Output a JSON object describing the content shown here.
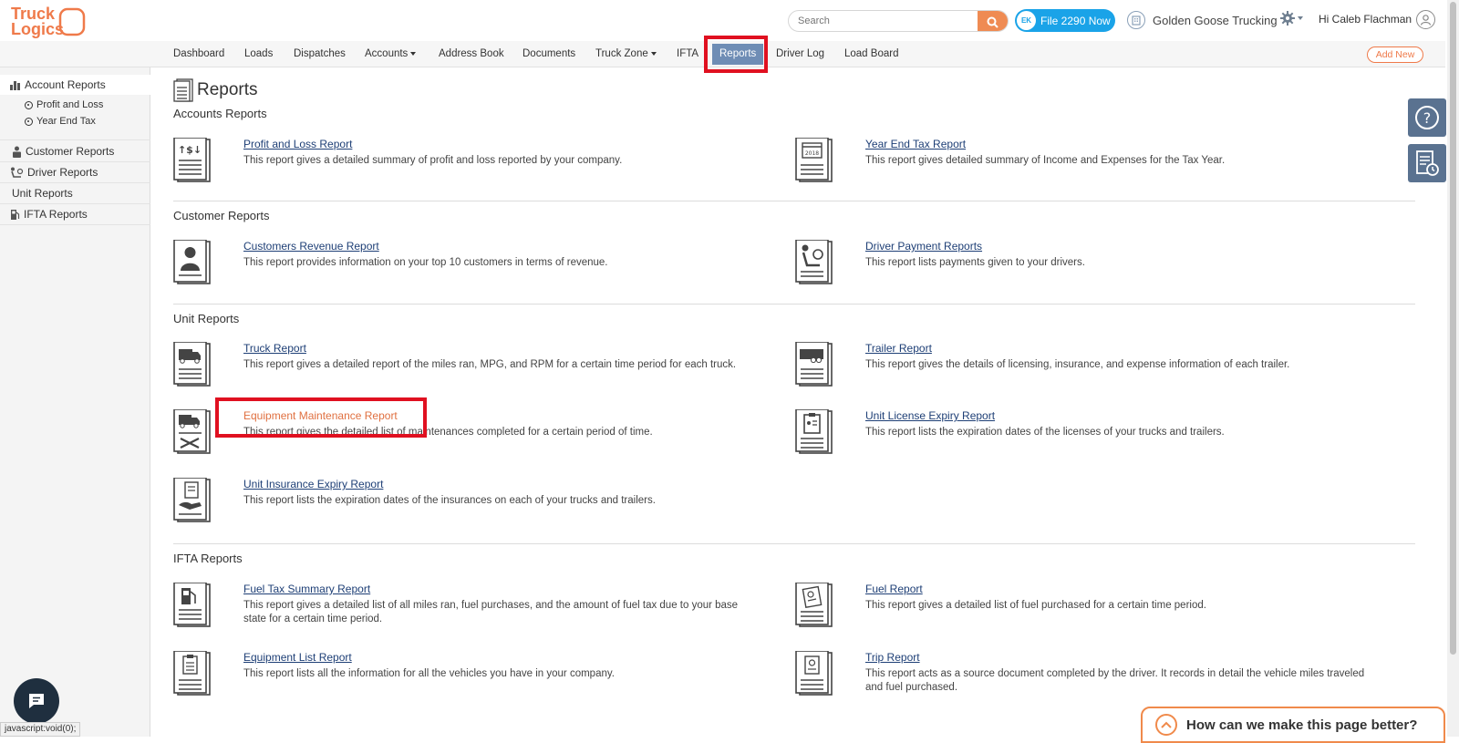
{
  "brand": {
    "logo_line1": "Truck",
    "logo_line2": "Logics",
    "accent": "#ef7a4a",
    "nav_active": "#6f8db5",
    "link": "#1e3f76"
  },
  "header": {
    "search_placeholder": "Search",
    "file_button": "File 2290 Now",
    "file_button_badge": "EK",
    "company_name": "Golden Goose Trucking",
    "greeting": "Hi Caleb Flachman"
  },
  "nav": {
    "items": [
      {
        "label": "Dashboard"
      },
      {
        "label": "Loads"
      },
      {
        "label": "Dispatches"
      },
      {
        "label": "Accounts"
      },
      {
        "label": "Address Book"
      },
      {
        "label": "Documents"
      },
      {
        "label": "Truck Zone"
      },
      {
        "label": "IFTA"
      },
      {
        "label": "Reports"
      },
      {
        "label": "Driver Log"
      },
      {
        "label": "Load Board"
      }
    ],
    "add_new": "Add New"
  },
  "sidebar": {
    "items": [
      {
        "label": "Account Reports"
      },
      {
        "label": "Profit and Loss"
      },
      {
        "label": "Year End Tax"
      },
      {
        "label": "Customer Reports"
      },
      {
        "label": "Driver Reports"
      },
      {
        "label": "Unit Reports"
      },
      {
        "label": "IFTA Reports"
      }
    ]
  },
  "main": {
    "title": "Reports",
    "sections": [
      {
        "title": "Accounts Reports",
        "reports": [
          {
            "name": "Profit and Loss Report",
            "desc": "This report gives a detailed summary of profit and loss reported by your company.",
            "icon": "profit-loss-icon"
          },
          {
            "name": "Year End Tax Report",
            "desc": "This report gives detailed summary of Income and Expenses for the Tax Year.",
            "icon": "calendar-2018-icon"
          }
        ]
      },
      {
        "title": "Customer Reports",
        "reports": [
          {
            "name": "Customers Revenue Report",
            "desc": "This report provides information on your top 10 customers in terms of revenue.",
            "icon": "customer-icon"
          },
          {
            "name": "Driver Payment Reports",
            "desc": "This report lists payments given to your drivers.",
            "icon": "driver-icon"
          }
        ]
      },
      {
        "title": "Unit Reports",
        "reports": [
          {
            "name": "Truck Report",
            "desc": "This report gives a detailed report of the miles ran, MPG, and RPM for a certain time period for each truck.",
            "icon": "truck-icon"
          },
          {
            "name": "Trailer Report",
            "desc": "This report gives the details of licensing, insurance, and expense information of each trailer.",
            "icon": "trailer-icon"
          },
          {
            "name": "Equipment Maintenance Report",
            "desc": "This report gives the detailed list of maintenances completed for a certain period of time.",
            "icon": "maintenance-icon"
          },
          {
            "name": "Unit License Expiry Report",
            "desc": "This report lists the expiration dates of the licenses of your trucks and trailers.",
            "icon": "license-icon"
          },
          {
            "name": "Unit Insurance Expiry Report",
            "desc": "This report lists the expiration dates of the insurances on each of your trucks and trailers.",
            "icon": "insurance-icon"
          }
        ]
      },
      {
        "title": "IFTA Reports",
        "reports": [
          {
            "name": "Fuel Tax Summary Report",
            "desc": "This report gives a detailed list of all miles ran, fuel purchases, and the amount of fuel tax due to your base state for a certain time period.",
            "icon": "fuel-pump-icon"
          },
          {
            "name": "Fuel Report",
            "desc": "This report gives a detailed list of fuel purchased for a certain time period.",
            "icon": "fuel-receipt-icon"
          },
          {
            "name": "Equipment List Report",
            "desc": "This report lists all the information for all the vehicles you have in your company.",
            "icon": "clipboard-icon"
          },
          {
            "name": "Trip Report",
            "desc": "This report acts as a source document completed by the driver. It records in detail the vehicle miles traveled and fuel purchased.",
            "icon": "trip-icon"
          }
        ]
      }
    ]
  },
  "status_bar": "javascript:void(0);",
  "feedback": "How can we make this page better?"
}
